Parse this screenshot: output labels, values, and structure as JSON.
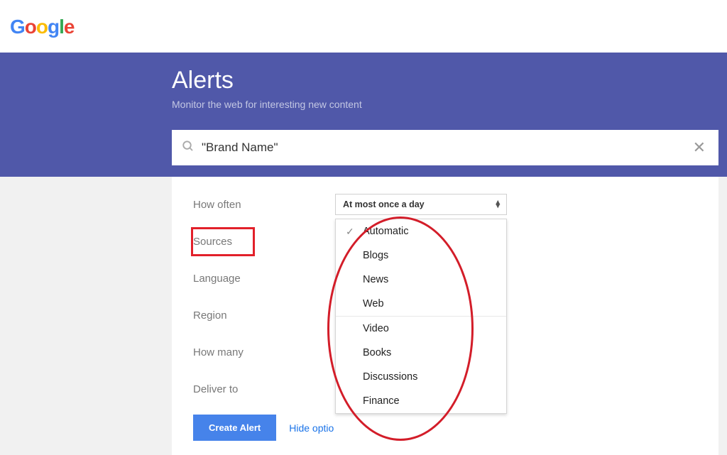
{
  "logo": {
    "g1": "G",
    "o1": "o",
    "o2": "o",
    "g2": "g",
    "l1": "l",
    "e1": "e"
  },
  "hero": {
    "title": "Alerts",
    "subtitle": "Monitor the web for interesting new content"
  },
  "search": {
    "value": "\"Brand Name\""
  },
  "options": {
    "how_often": {
      "label": "How often",
      "value": "At most once a day"
    },
    "sources": {
      "label": "Sources"
    },
    "language": {
      "label": "Language"
    },
    "region": {
      "label": "Region"
    },
    "how_many": {
      "label": "How many"
    },
    "deliver_to": {
      "label": "Deliver to"
    }
  },
  "dropdown": {
    "group1": [
      "Automatic",
      "Blogs",
      "News",
      "Web"
    ],
    "group2": [
      "Video",
      "Books",
      "Discussions",
      "Finance"
    ]
  },
  "actions": {
    "create": "Create Alert",
    "hide": "Hide optio"
  }
}
